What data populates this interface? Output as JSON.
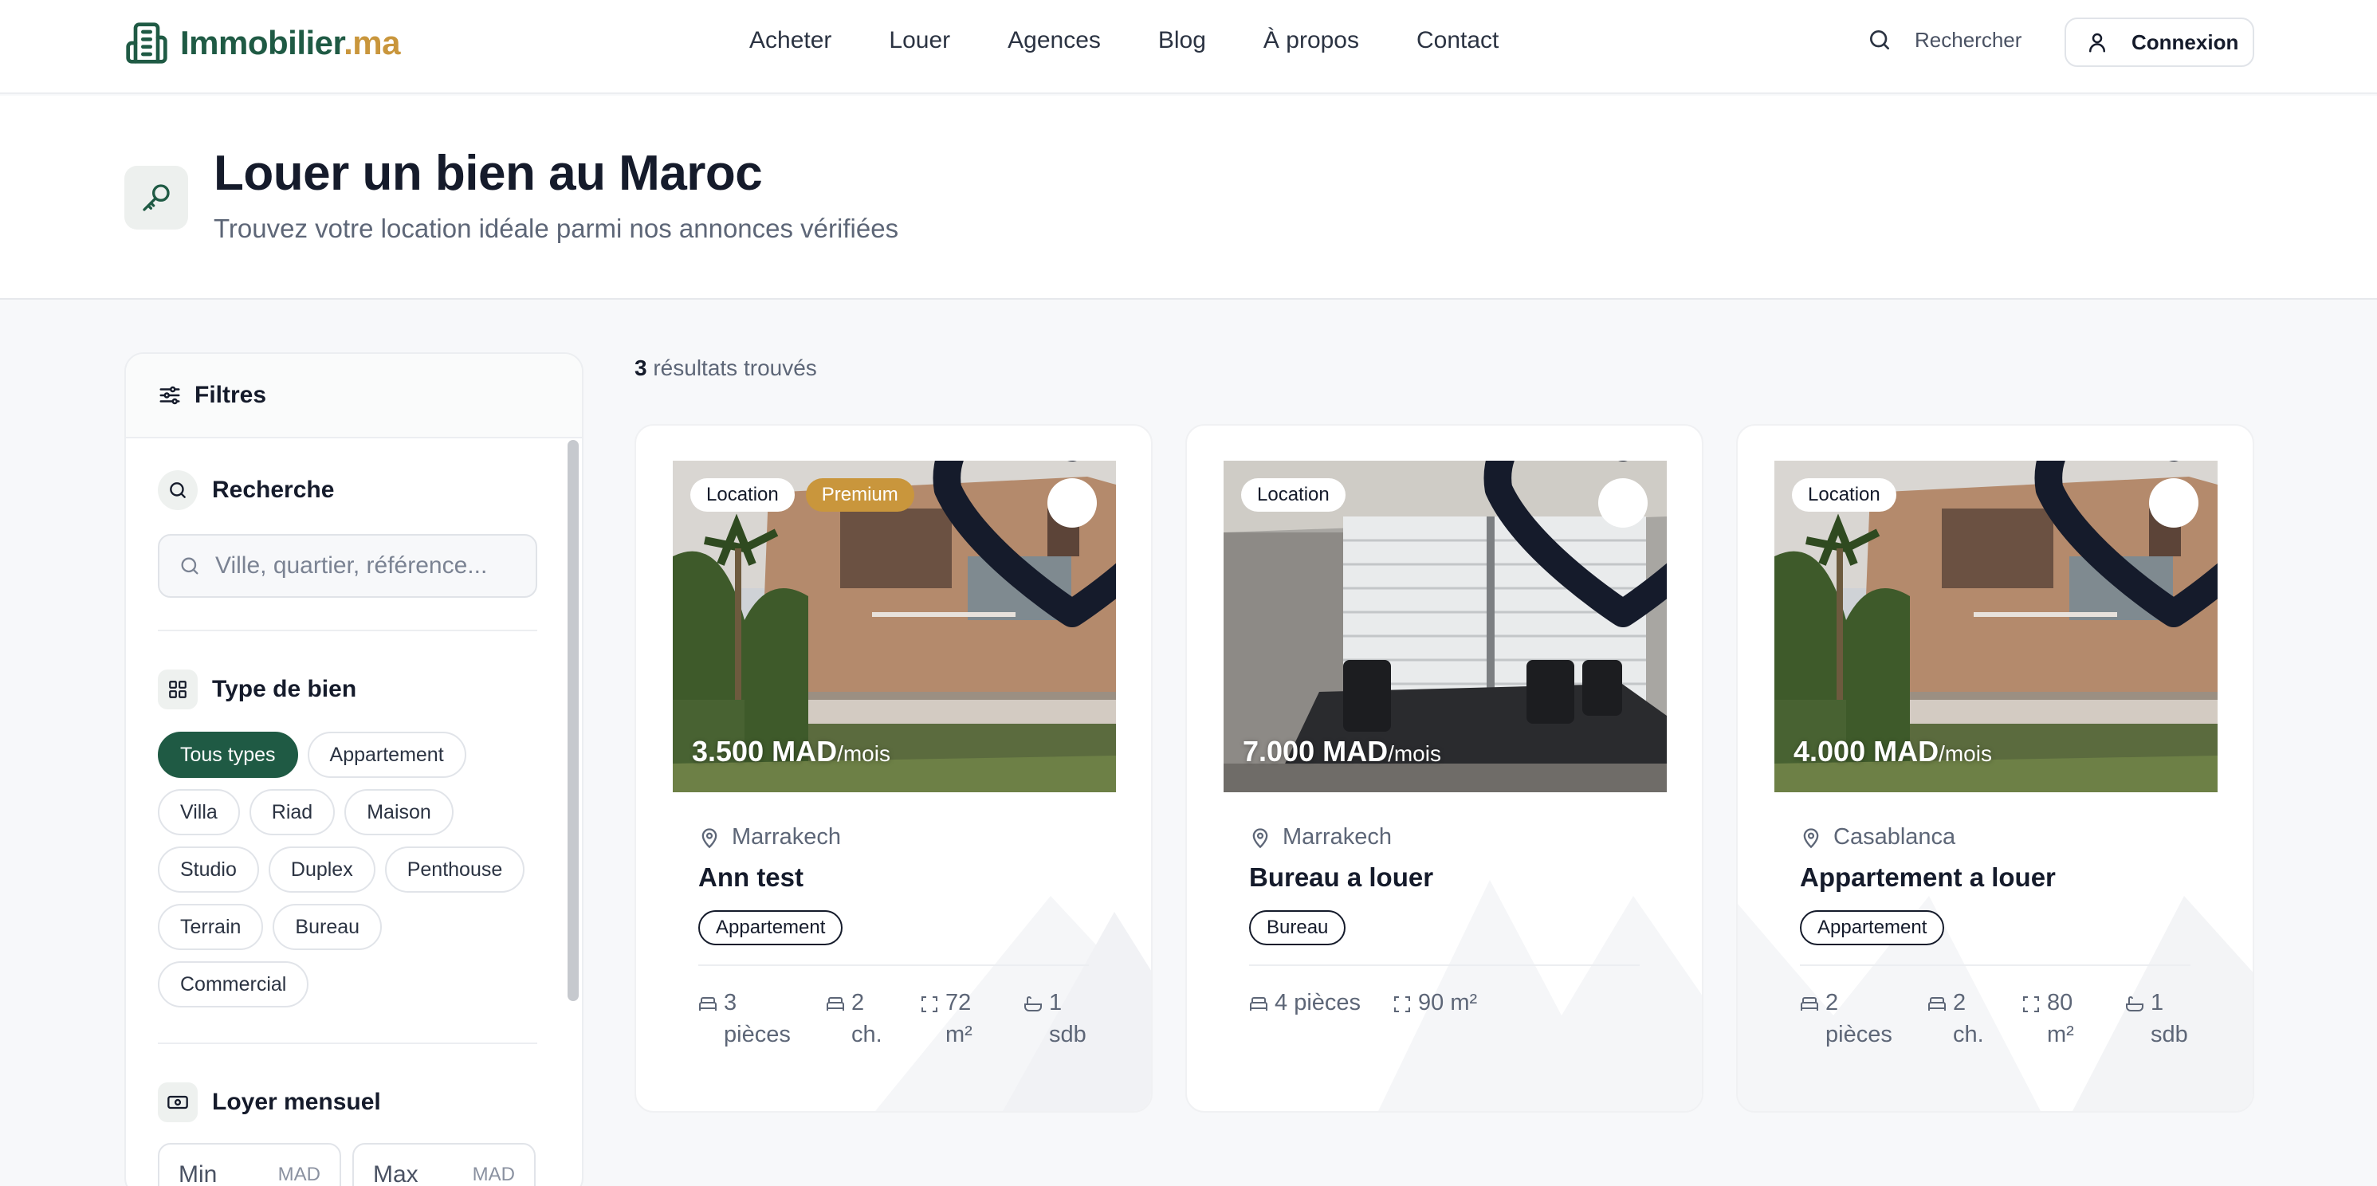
{
  "header": {
    "logo_main": "Immobilier",
    "logo_tld": ".ma",
    "nav": [
      "Acheter",
      "Louer",
      "Agences",
      "Blog",
      "À propos",
      "Contact"
    ],
    "search_label": "Rechercher",
    "login_label": "Connexion"
  },
  "hero": {
    "title": "Louer un bien au Maroc",
    "subtitle": "Trouvez votre location idéale parmi nos annonces vérifiées"
  },
  "filters": {
    "title": "Filtres",
    "search": {
      "title": "Recherche",
      "placeholder": "Ville, quartier, référence..."
    },
    "type": {
      "title": "Type de bien",
      "options": [
        "Tous types",
        "Appartement",
        "Villa",
        "Riad",
        "Maison",
        "Studio",
        "Duplex",
        "Penthouse",
        "Terrain",
        "Bureau",
        "Commercial"
      ],
      "selected": "Tous types"
    },
    "rent": {
      "title": "Loyer mensuel",
      "min_label": "Min",
      "max_label": "Max",
      "unit": "MAD"
    }
  },
  "results": {
    "count": "3",
    "count_label": "résultats trouvés",
    "listings": [
      {
        "badges": [
          "Location",
          "Premium"
        ],
        "price": "3.500 MAD",
        "per": "/mois",
        "city": "Marrakech",
        "title": "Ann test",
        "type": "Appartement",
        "specs": [
          {
            "icon": "bed-icon",
            "value": "3",
            "unit": "pièces"
          },
          {
            "icon": "bed-icon",
            "value": "2",
            "unit": "ch."
          },
          {
            "icon": "area-icon",
            "value": "72",
            "unit": "m²"
          },
          {
            "icon": "bath-icon",
            "value": "1",
            "unit": "sdb"
          }
        ]
      },
      {
        "badges": [
          "Location"
        ],
        "price": "7.000 MAD",
        "per": "/mois",
        "city": "Marrakech",
        "title": "Bureau a louer",
        "type": "Bureau",
        "specs": [
          {
            "icon": "bed-icon",
            "value": "4",
            "unit": "pièces"
          },
          {
            "icon": "area-icon",
            "value": "90",
            "unit": "m²"
          }
        ]
      },
      {
        "badges": [
          "Location"
        ],
        "price": "4.000 MAD",
        "per": "/mois",
        "city": "Casablanca",
        "title": "Appartement a louer",
        "type": "Appartement",
        "specs": [
          {
            "icon": "bed-icon",
            "value": "2",
            "unit": "pièces"
          },
          {
            "icon": "bed-icon",
            "value": "2",
            "unit": "ch."
          },
          {
            "icon": "area-icon",
            "value": "80",
            "unit": "m²"
          },
          {
            "icon": "bath-icon",
            "value": "1",
            "unit": "sdb"
          }
        ]
      }
    ]
  },
  "colors": {
    "brand": "#1f5a44",
    "accent": "#c9963c",
    "text": "#151b2b",
    "muted": "#5d6677"
  }
}
